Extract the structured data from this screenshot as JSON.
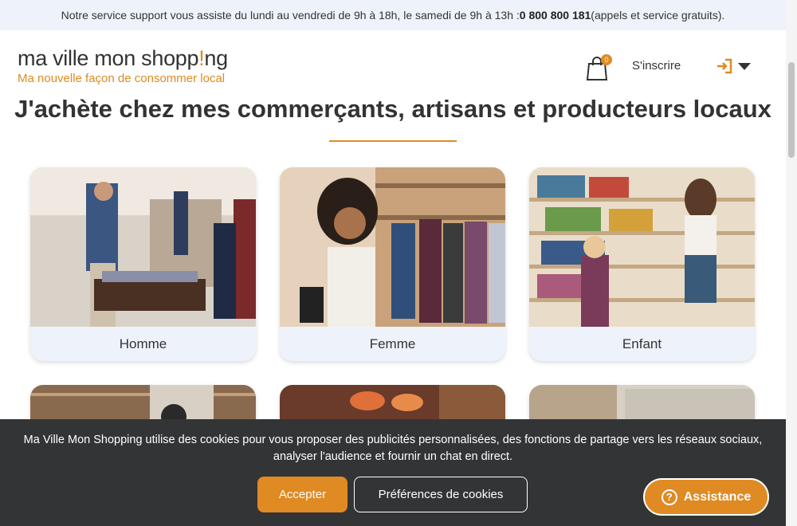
{
  "topbar": {
    "text": "Notre service support vous assiste du lundi au vendredi de 9h à 18h, le samedi de 9h à 13h : ",
    "phone": "0 800 800 181",
    "suffix": " (appels et service gratuits)."
  },
  "header": {
    "logo_part1": "ma ville mon shopp",
    "logo_part2": "!",
    "logo_part3": "ng",
    "tagline": "Ma nouvelle façon de consommer local",
    "cart_count": "0",
    "signup_label": "S'inscrire"
  },
  "main": {
    "headline": "J'achète chez mes commerçants, artisans et producteurs locaux",
    "categories": [
      {
        "label": "Homme"
      },
      {
        "label": "Femme"
      },
      {
        "label": "Enfant"
      }
    ]
  },
  "cookie_banner": {
    "text": "Ma Ville Mon Shopping utilise des cookies pour vous proposer des publicités personnalisées, des fonctions de partage vers les réseaux sociaux, analyser l'audience et fournir un chat en direct.",
    "accept_label": "Accepter",
    "prefs_label": "Préférences de cookies"
  },
  "assistance": {
    "label": "Assistance",
    "icon": "?"
  },
  "colors": {
    "accent": "#e08a23",
    "light_bg": "#eef3fb",
    "banner_bg": "#333436"
  }
}
